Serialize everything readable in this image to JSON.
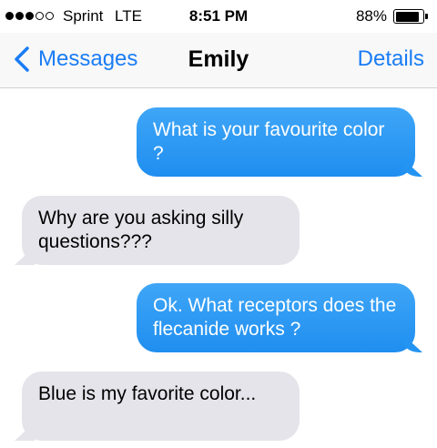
{
  "status_bar": {
    "carrier": "Sprint",
    "network": "LTE",
    "time": "8:51 PM",
    "battery_percent": "88%",
    "battery_level": 0.88,
    "signal_bars_filled": 3,
    "signal_bars_total": 5
  },
  "nav": {
    "back_label": "Messages",
    "title": "Emily",
    "details_label": "Details",
    "accent_color": "#1a7cf5"
  },
  "messages": [
    {
      "direction": "sent",
      "text": "What is your favourite color ?"
    },
    {
      "direction": "received",
      "text": "Why are you asking silly questions???"
    },
    {
      "direction": "sent",
      "text": "Ok. What receptors does the flecanide works ?"
    },
    {
      "direction": "received",
      "text": "Blue is my favorite color..."
    }
  ],
  "colors": {
    "sent_bubble": "#2394f1",
    "received_bubble": "#e4e4ea"
  }
}
